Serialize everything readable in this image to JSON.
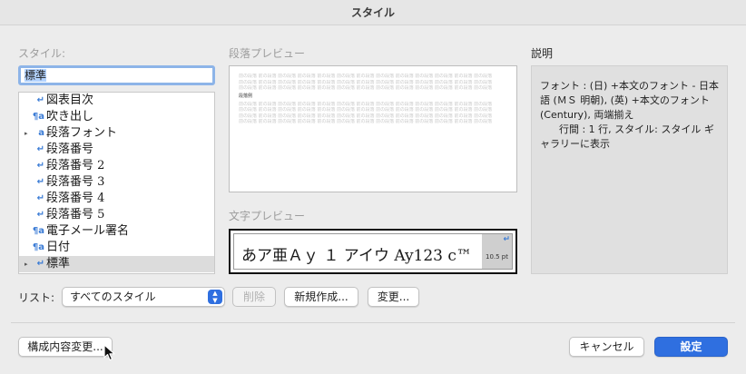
{
  "window": {
    "title": "スタイル"
  },
  "labels": {
    "style": "スタイル:",
    "paragraph_preview": "段落プレビュー",
    "char_preview": "文字プレビュー",
    "description": "説明",
    "list": "リスト:"
  },
  "style_name": "標準",
  "styles": [
    {
      "label": "図表目次",
      "icon": "↵",
      "icon_name": "paragraph-return-icon",
      "expand": ""
    },
    {
      "label": "吹き出し",
      "icon": "¶a",
      "icon_name": "linked-style-icon",
      "expand": ""
    },
    {
      "label": "段落フォント",
      "icon": "a",
      "icon_name": "character-style-icon",
      "expand": "▸"
    },
    {
      "label": "段落番号",
      "icon": "↵",
      "icon_name": "paragraph-return-icon",
      "expand": ""
    },
    {
      "label": "段落番号 2",
      "icon": "↵",
      "icon_name": "paragraph-return-icon",
      "expand": ""
    },
    {
      "label": "段落番号 3",
      "icon": "↵",
      "icon_name": "paragraph-return-icon",
      "expand": ""
    },
    {
      "label": "段落番号 4",
      "icon": "↵",
      "icon_name": "paragraph-return-icon",
      "expand": ""
    },
    {
      "label": "段落番号 5",
      "icon": "↵",
      "icon_name": "paragraph-return-icon",
      "expand": ""
    },
    {
      "label": "電子メール署名",
      "icon": "¶a",
      "icon_name": "linked-style-icon",
      "expand": ""
    },
    {
      "label": "日付",
      "icon": "¶a",
      "icon_name": "linked-style-icon",
      "expand": ""
    },
    {
      "label": "標準",
      "icon": "↵",
      "icon_name": "paragraph-return-icon",
      "expand": "▸"
    }
  ],
  "selected_style_index": 10,
  "paragraph_preview": {
    "filler_line": "前の段落 前の段落 前の段落 前の段落 前の段落 前の段落 前の段落 前の段落 前の段落 前の段落 前の段落 前の段落 前の段落",
    "current": "段落例"
  },
  "char_preview": {
    "text": "あア亜Ａｙ １ アイウ Ay123 c™",
    "size": "10.5 pt",
    "return_mark": "↵"
  },
  "description": "フォント : (日) +本文のフォント - 日本語 (ＭＳ 明朝), (英) +本文のフォント (Century), 両端揃え\n      行間 : 1 行, スタイル: スタイル ギャラリーに表示",
  "list_select": {
    "value": "すべてのスタイル",
    "arrows": "▲▼"
  },
  "buttons": {
    "delete": "削除",
    "new": "新規作成...",
    "modify": "変更...",
    "organizer": "構成内容変更...",
    "cancel": "キャンセル",
    "apply": "設定"
  },
  "colors": {
    "accent": "#2f6fe0",
    "icon_blue": "#3a7bd5",
    "focus_ring": "#8db4e8"
  }
}
